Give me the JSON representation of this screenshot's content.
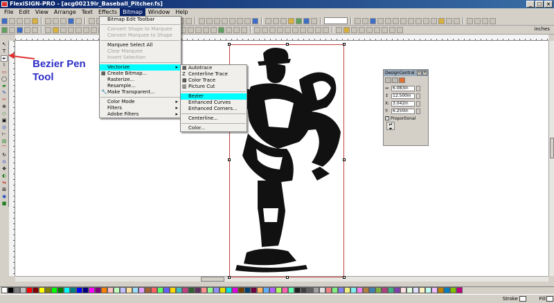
{
  "window": {
    "title": "FlexiSIGN-PRO - [acg00219lr_Baseball_Pitcher.fs]"
  },
  "menubar": [
    "File",
    "Edit",
    "View",
    "Arrange",
    "Text",
    "Effects",
    "Bitmap",
    "Window",
    "Help"
  ],
  "toolbar": {
    "units_label": "inches"
  },
  "annotation": {
    "line1": "Bezier Pen",
    "line2": "Tool"
  },
  "bitmap_menu": [
    {
      "label": "Bitmap Edit Toolbar",
      "state": "normal"
    },
    {
      "sep": true
    },
    {
      "label": "Convert Shape to Marquee",
      "state": "disabled"
    },
    {
      "label": "Convert Marquee to Shape",
      "state": "disabled"
    },
    {
      "sep": true
    },
    {
      "label": "Marquee Select All",
      "state": "normal"
    },
    {
      "label": "Clear Marquee",
      "state": "disabled"
    },
    {
      "label": "Invert Selection",
      "state": "disabled"
    },
    {
      "sep": true
    },
    {
      "label": "Vectorize",
      "state": "highlight",
      "submenu": true
    },
    {
      "label": "Create Bitmap...",
      "state": "normal",
      "icon": "create-bitmap-icon"
    },
    {
      "label": "Rasterize...",
      "state": "normal"
    },
    {
      "label": "Resample...",
      "state": "normal"
    },
    {
      "label": "Make Transparent...",
      "state": "normal",
      "icon": "transparent-icon"
    },
    {
      "sep": true
    },
    {
      "label": "Color Mode",
      "state": "normal",
      "submenu": true
    },
    {
      "label": "Filters",
      "state": "normal",
      "submenu": true
    },
    {
      "label": "Adobe Filters",
      "state": "normal",
      "submenu": true
    }
  ],
  "vectorize_menu": [
    {
      "label": "Autotrace",
      "icon": "autotrace-icon"
    },
    {
      "label": "Centerline Trace",
      "icon": "centerline-icon"
    },
    {
      "label": "Color Trace",
      "icon": "color-trace-icon"
    },
    {
      "label": "Picture Cut",
      "icon": "picture-cut-icon"
    },
    {
      "sep": true
    },
    {
      "label": "Bezier",
      "highlight": true
    },
    {
      "label": "Enhanced Curves"
    },
    {
      "label": "Enhanced Corners..."
    },
    {
      "sep": true
    },
    {
      "label": "Centerline..."
    },
    {
      "sep": true
    },
    {
      "label": "Color..."
    }
  ],
  "design_central": {
    "title": "DesignCentral",
    "width": "6.083in",
    "height": "12.500in",
    "x": "3.042in",
    "y": "6.250in",
    "x_label": "X:",
    "y_label": "Y:",
    "proportional_label": "Proportional"
  },
  "status": {
    "stroke_label": "Stroke",
    "fill_label": "Fill"
  },
  "palette_colors": [
    "#ffffff",
    "#000000",
    "#808080",
    "#c0c0c0",
    "#ff0000",
    "#800000",
    "#ffff00",
    "#808000",
    "#00ff00",
    "#008000",
    "#00ffff",
    "#008080",
    "#0000ff",
    "#000080",
    "#ff00ff",
    "#800080",
    "#ff8000",
    "#ffc0c0",
    "#c0ffc0",
    "#c0c0ff",
    "#ffe0a0",
    "#a0e0ff",
    "#e0a0ff",
    "#a06030",
    "#ff6060",
    "#60ff60",
    "#6060ff",
    "#ffd700",
    "#40c0c0",
    "#c04080",
    "#306030",
    "#603060",
    "#ff9090",
    "#90ff90",
    "#9090ff",
    "#e0e000",
    "#00e0e0",
    "#e000e0",
    "#704000",
    "#004070",
    "#700040",
    "#ffb060",
    "#60b0ff",
    "#b060ff",
    "#b0ff60",
    "#ff60b0",
    "#60ffb0",
    "#202020",
    "#404040",
    "#606060",
    "#a0a0a0",
    "#e0e0e0",
    "#f08080",
    "#80f080",
    "#8080f0",
    "#f0f080",
    "#80f0f0",
    "#f080f0",
    "#b08040",
    "#4080b0",
    "#80b040",
    "#b04080",
    "#40b080",
    "#8040b0",
    "#ffe0e0",
    "#e0ffe0",
    "#e0e0ff",
    "#fff0c0",
    "#c0fff0",
    "#f0c0ff",
    "#c08000",
    "#0080c0",
    "#80c000",
    "#c00080"
  ]
}
